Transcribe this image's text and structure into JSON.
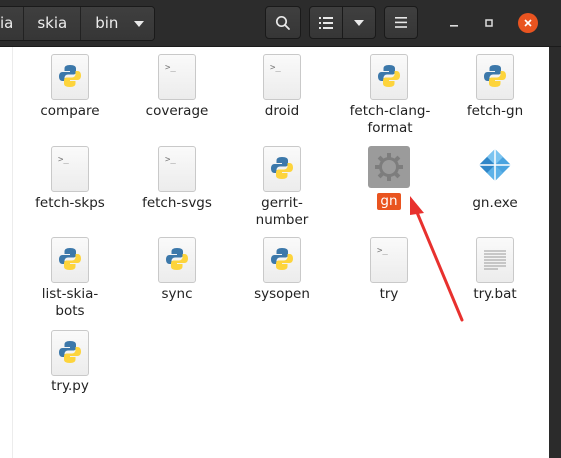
{
  "breadcrumbs": [
    "ia",
    "skia",
    "bin"
  ],
  "files": [
    {
      "label": "compare",
      "type": "python"
    },
    {
      "label": "coverage",
      "type": "script"
    },
    {
      "label": "droid",
      "type": "script"
    },
    {
      "label": "fetch-clang-format",
      "type": "python"
    },
    {
      "label": "fetch-gn",
      "type": "python"
    },
    {
      "label": "fetch-skps",
      "type": "script"
    },
    {
      "label": "fetch-svgs",
      "type": "script"
    },
    {
      "label": "gerrit-number",
      "type": "python"
    },
    {
      "label": "gn",
      "type": "executable"
    },
    {
      "label": "gn.exe",
      "type": "windows-exe"
    },
    {
      "label": "list-skia-bots",
      "type": "python"
    },
    {
      "label": "sync",
      "type": "python"
    },
    {
      "label": "sysopen",
      "type": "python"
    },
    {
      "label": "try",
      "type": "script"
    },
    {
      "label": "try.bat",
      "type": "text"
    },
    {
      "label": "try.py",
      "type": "python"
    }
  ],
  "colors": {
    "accent": "#e95420",
    "annotation_arrow": "#e8312e"
  }
}
